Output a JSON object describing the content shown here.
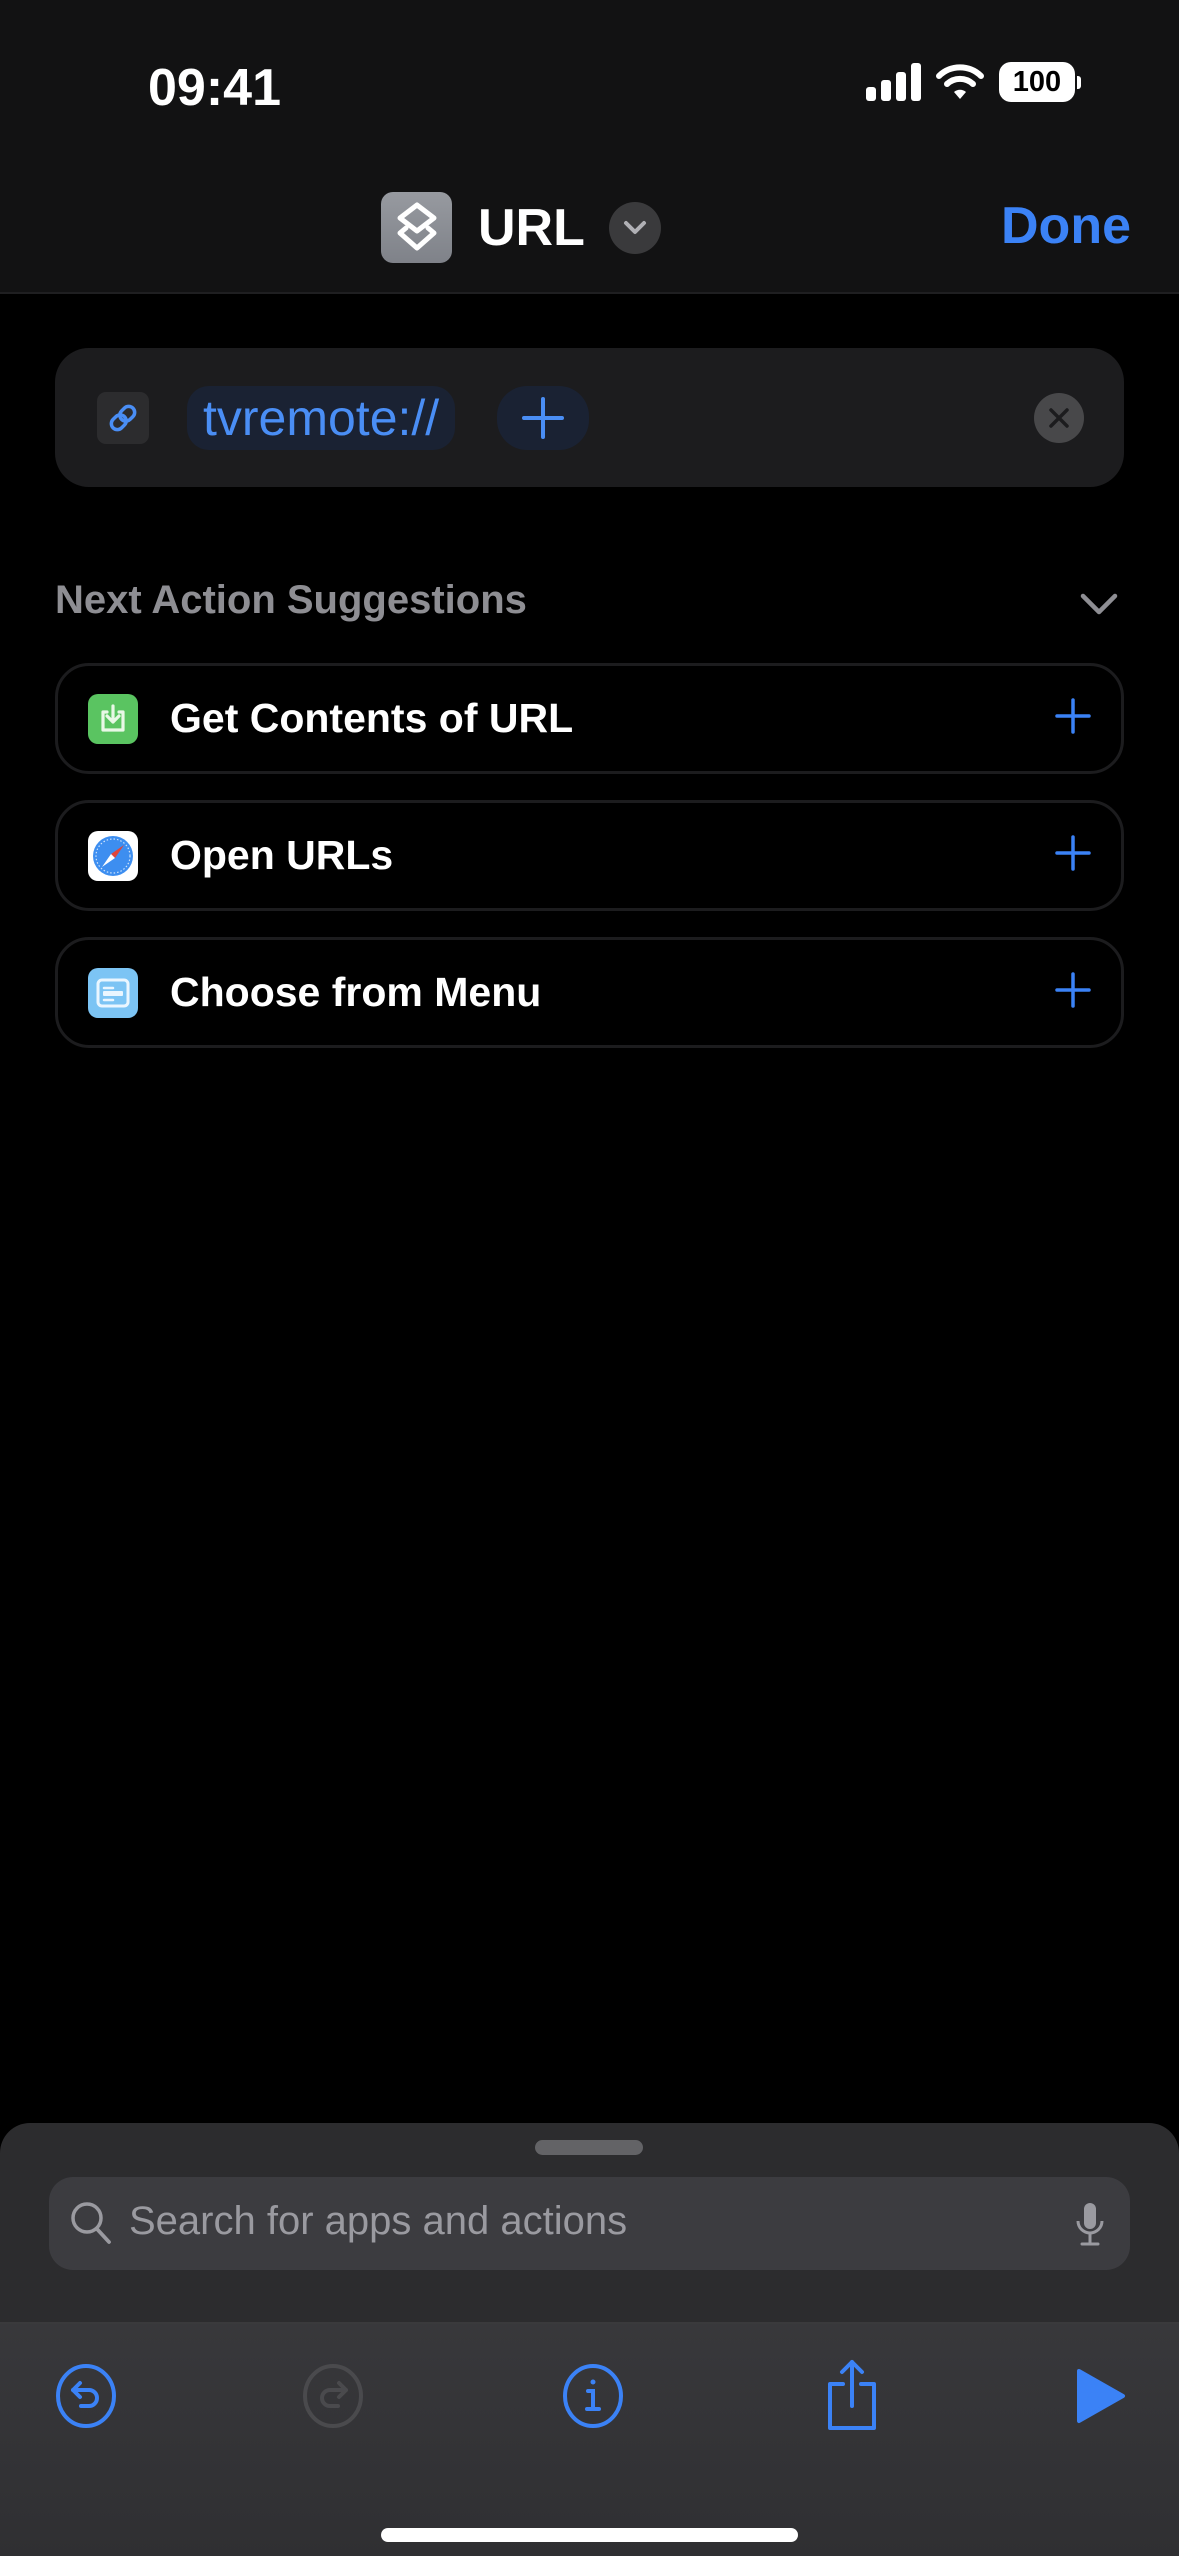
{
  "status_bar": {
    "time": "09:41",
    "battery": "100",
    "icons": [
      "cellular-signal-icon",
      "wifi-icon",
      "battery-icon"
    ]
  },
  "nav": {
    "app_icon": "shortcuts-layers-icon",
    "title": "URL",
    "title_menu_icon": "chevron-down-icon",
    "done_label": "Done"
  },
  "url_field": {
    "icon": "link-icon",
    "value": "tvremote://",
    "add_icon": "plus-icon",
    "clear_icon": "close-icon"
  },
  "suggestions": {
    "header": "Next Action Suggestions",
    "collapse_icon": "chevron-down-icon",
    "items": [
      {
        "label": "Get Contents of URL",
        "icon": "download-tray-icon",
        "icon_color": "#5ac461"
      },
      {
        "label": "Open URLs",
        "icon": "safari-compass-icon",
        "icon_color": "#ffffff"
      },
      {
        "label": "Choose from Menu",
        "icon": "menu-list-icon",
        "icon_color": "#7cc4f4"
      }
    ]
  },
  "search": {
    "placeholder": "Search for apps and actions",
    "search_icon": "search-icon",
    "mic_icon": "microphone-icon"
  },
  "toolbar": {
    "buttons": [
      {
        "name": "undo",
        "icon": "undo-icon",
        "enabled": true
      },
      {
        "name": "redo",
        "icon": "redo-icon",
        "enabled": false
      },
      {
        "name": "info",
        "icon": "info-icon",
        "enabled": true
      },
      {
        "name": "share",
        "icon": "share-icon",
        "enabled": true
      },
      {
        "name": "run",
        "icon": "play-icon",
        "enabled": true
      }
    ]
  },
  "colors": {
    "accent": "#3b82f6",
    "background": "#000000",
    "header_bg": "#121213",
    "card_bg": "#1c1c1e",
    "secondary_text": "#8e8e93"
  }
}
